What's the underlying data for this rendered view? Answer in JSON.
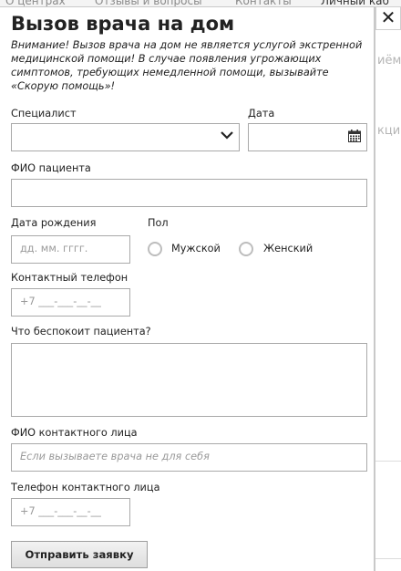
{
  "background": {
    "nav_items": [
      "О центрах",
      "Отзывы и вопросы",
      "Контакты",
      "Личный каб"
    ],
    "fragments": [
      "иём",
      "кци"
    ]
  },
  "modal": {
    "title": "Вызов врача на дом",
    "close_glyph": "✕",
    "warning": "Внимание! Вызов врача на дом не является услугой экстренной медицинской помощи! В случае появления угрожающих симптомов, требующих немедленной помощи, вызывайте «Скорую помощь»!",
    "specialist": {
      "label": "Специалист",
      "value": ""
    },
    "date": {
      "label": "Дата",
      "value": ""
    },
    "patient_name": {
      "label": "ФИО пациента",
      "value": ""
    },
    "birth_date": {
      "label": "Дата рождения",
      "placeholder": "дд. мм. гггг."
    },
    "gender": {
      "label": "Пол",
      "options": [
        "Мужской",
        "Женский"
      ],
      "selected": null
    },
    "phone": {
      "label": "Контактный телефон",
      "placeholder": "+7 ___-___-__-__"
    },
    "complaint": {
      "label": "Что беспокоит пациента?",
      "value": ""
    },
    "contact_name": {
      "label": "ФИО контактного лица",
      "placeholder": "Если вызываете врача не для себя"
    },
    "contact_phone": {
      "label": "Телефон контактного лица",
      "placeholder": "+7 ___-___-__-__"
    },
    "submit_label": "Отправить заявку"
  },
  "icons": {
    "dropdown": "chevron-down-icon",
    "calendar": "calendar-icon",
    "close": "close-icon"
  }
}
